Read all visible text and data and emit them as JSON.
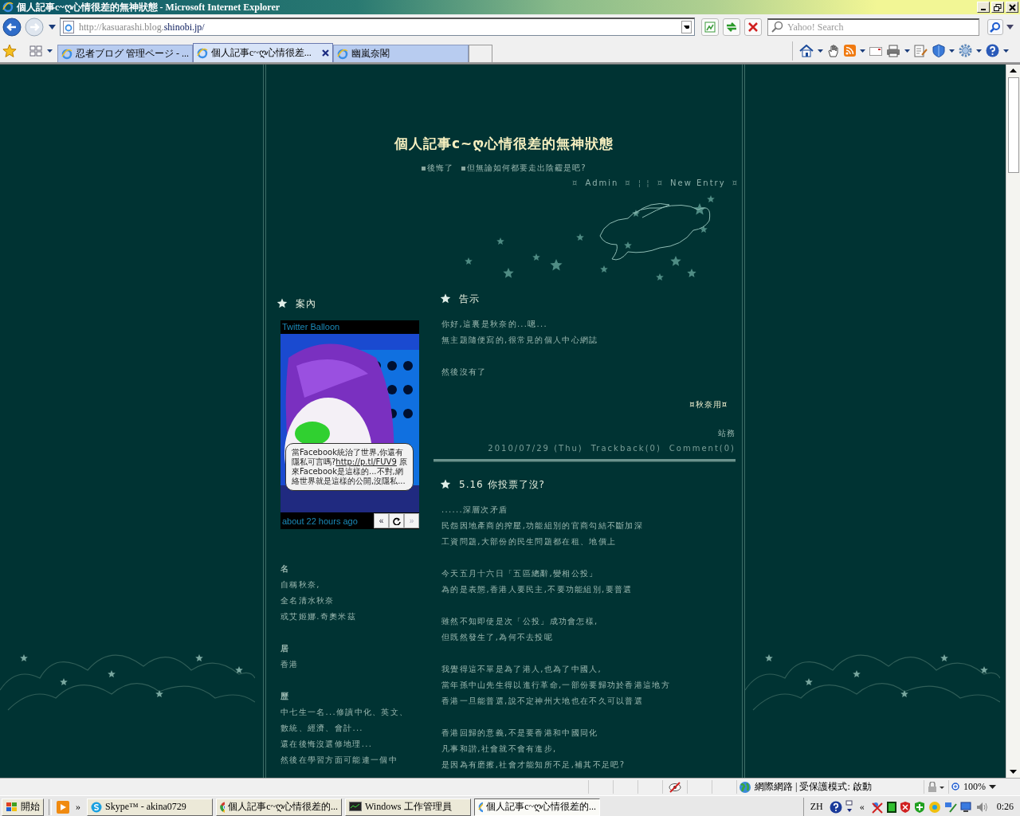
{
  "window": {
    "title": "個人記事c~ღ心情很差的無神狀態 - Microsoft Internet Explorer"
  },
  "address_bar": {
    "url_prefix": "http://kasuarashi.blog.",
    "url_domain": "shinobi.jp/"
  },
  "search": {
    "placeholder": "Yahoo! Search"
  },
  "tabs": [
    {
      "label": "忍者ブログ 管理ページ - ...",
      "selected": false
    },
    {
      "label": "個人記事c~ღ心情很差...",
      "selected": true
    },
    {
      "label": "幽嵐奈閣",
      "selected": false
    }
  ],
  "blog": {
    "title": "個人記事c~ღ心情很差的無神狀態",
    "subtitle_items": [
      "後悔了",
      "但無論如何都要走出陰霾是吧?"
    ],
    "nav": [
      {
        "kind": "mark",
        "text": "¤"
      },
      {
        "kind": "link",
        "text": "Admin"
      },
      {
        "kind": "mark",
        "text": "¤"
      },
      {
        "kind": "mark",
        "text": "¦ ¦"
      },
      {
        "kind": "mark",
        "text": "¤"
      },
      {
        "kind": "link",
        "text": "New Entry"
      },
      {
        "kind": "mark",
        "text": "¤"
      }
    ]
  },
  "sidebar": {
    "heading": "案內",
    "twitter": {
      "title": "Twitter Balloon",
      "tweet_before": "當Facebook統治了世界,你還有隱私可言嗎?",
      "tweet_link": "http://p.tl/FUV9",
      "tweet_after": "原來Facebook是這樣的...不對,網絡世界就是這樣的公開,沒隱私...",
      "time": "about 22 hours ago",
      "prev": "«",
      "next": "»"
    },
    "profile": [
      {
        "label": "名",
        "lines": [
          "自稱秋奈,",
          "全名清水秋奈",
          "或艾姬娜.奇奧米茲"
        ]
      },
      {
        "label": "居",
        "lines": [
          "香港"
        ]
      },
      {
        "label": "歷",
        "lines": [
          "中七生一名...修讀中化、英文、",
          "數統、經濟、會計...",
          "還在後悔沒選修地理...",
          "然後在學習方面可能連一個中"
        ]
      }
    ]
  },
  "posts": [
    {
      "title": "告示",
      "paragraphs": [
        [
          "你好,這裏是秋奈的...嗯...",
          "無主題隨便寫的,很常見的個人中心網誌"
        ],
        [
          "然後沒有了"
        ]
      ],
      "signature": "¤秋奈用¤",
      "category": "站務",
      "date": "2010/07/29 (Thu)",
      "trackback": "Trackback(0)",
      "comment": "Comment(0)"
    },
    {
      "title": "5.16  你投票了沒?",
      "paragraphs": [
        [
          "......深層次矛盾",
          "民怨因地產商的搾壓,功能組別的官商勾結不斷加深",
          "工資問題,大部份的民生問題都在租、地價上"
        ],
        [
          "今天五月十六日「五區總辭,變相公投」",
          "為的是表態,香港人要民主,不要功能組別,要普選"
        ],
        [
          "雖然不知即使是次「公投」成功會怎樣,",
          "但既然發生了,為何不去投呢"
        ],
        [
          "我覺得這不單是為了港人,也為了中國人,",
          "當年孫中山先生得以進行革命,一部份要歸功於香港這地方",
          "香港一旦能普選,說不定神州大地也在不久可以普選"
        ],
        [
          "香港回歸的意義,不是要香港和中國同化",
          "凡事和諧,社會就不會有進步,",
          "是因為有磨擦,社會才能知所不足,補其不足吧?"
        ]
      ]
    }
  ],
  "status_bar": {
    "zone": "網際網路 | 受保護模式: 啟動",
    "zoom": "100%"
  },
  "taskbar": {
    "start": "開始",
    "more": "»",
    "items": [
      {
        "label": "Skype™ - akina0729",
        "kind": "skype",
        "selected": false
      },
      {
        "label": "個人記事c~ღ心情很差的...",
        "kind": "chrome",
        "selected": false
      },
      {
        "label": "Windows 工作管理員",
        "kind": "taskmgr",
        "selected": false
      },
      {
        "label": "個人記事c~ღ心情很差的...",
        "kind": "ie",
        "selected": true
      }
    ],
    "language": "ZH",
    "tray_more": "«",
    "clock": "0:26"
  }
}
